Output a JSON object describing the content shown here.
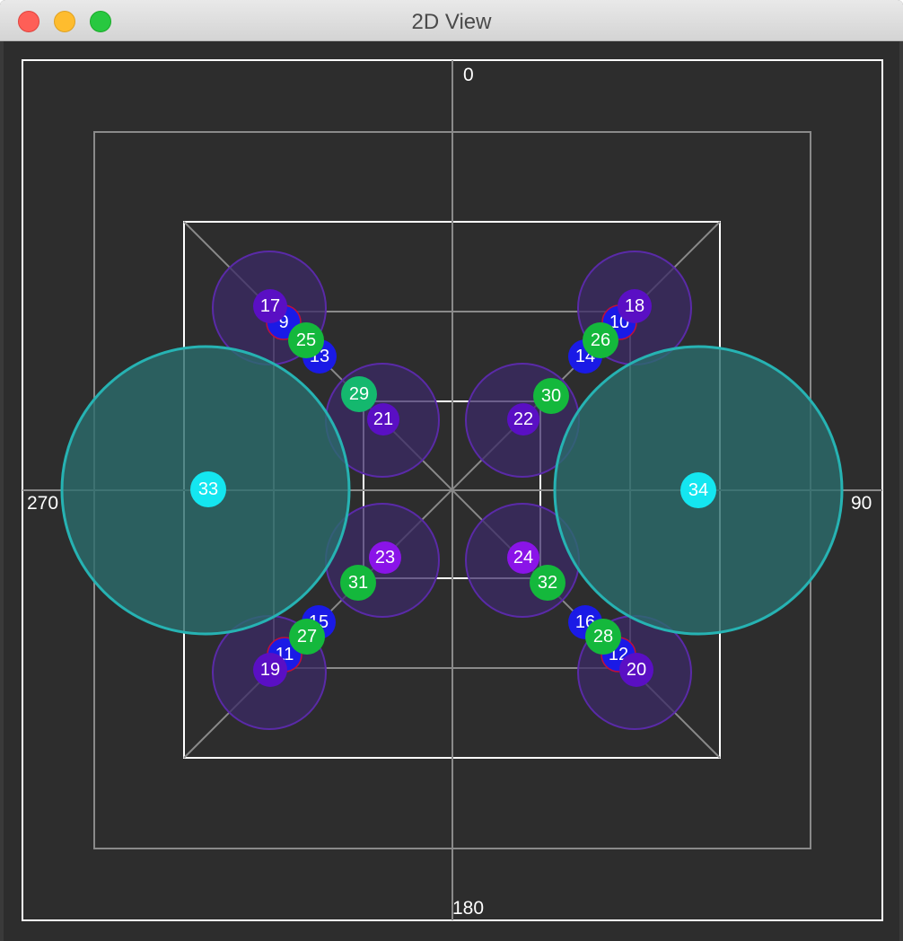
{
  "window": {
    "title": "2D View"
  },
  "axis_labels": {
    "top": "0",
    "right": "90",
    "bottom": "180",
    "left": "270"
  },
  "colors": {
    "background": "#2d2d2d",
    "blue": "#1a1ae6",
    "green": "#14b83c",
    "purple": "#5a0fc4",
    "violet": "#8a14e8",
    "cyan": "#14e6f0",
    "teal_fill": "#2a6b6b",
    "teal_stroke": "#26b3b3",
    "purple_halo_fill": "#3b2a66",
    "purple_halo_stroke": "#5a2aa8"
  },
  "markers": [
    {
      "id": "9",
      "label": "9",
      "color": "blue"
    },
    {
      "id": "10",
      "label": "10",
      "color": "blue"
    },
    {
      "id": "11",
      "label": "11",
      "color": "blue"
    },
    {
      "id": "12",
      "label": "12",
      "color": "blue"
    },
    {
      "id": "13",
      "label": "13",
      "color": "blue"
    },
    {
      "id": "14",
      "label": "14",
      "color": "blue"
    },
    {
      "id": "15",
      "label": "15",
      "color": "blue"
    },
    {
      "id": "16",
      "label": "16",
      "color": "blue"
    },
    {
      "id": "17",
      "label": "17",
      "color": "purple"
    },
    {
      "id": "18",
      "label": "18",
      "color": "purple"
    },
    {
      "id": "19",
      "label": "19",
      "color": "purple"
    },
    {
      "id": "20",
      "label": "20",
      "color": "purple"
    },
    {
      "id": "21",
      "label": "21",
      "color": "purple"
    },
    {
      "id": "22",
      "label": "22",
      "color": "purple"
    },
    {
      "id": "23",
      "label": "23",
      "color": "violet"
    },
    {
      "id": "24",
      "label": "24",
      "color": "violet"
    },
    {
      "id": "25",
      "label": "25",
      "color": "green"
    },
    {
      "id": "26",
      "label": "26",
      "color": "green"
    },
    {
      "id": "27",
      "label": "27",
      "color": "green"
    },
    {
      "id": "28",
      "label": "28",
      "color": "green"
    },
    {
      "id": "29",
      "label": "29",
      "color": "green"
    },
    {
      "id": "30",
      "label": "30",
      "color": "green"
    },
    {
      "id": "31",
      "label": "31",
      "color": "green"
    },
    {
      "id": "32",
      "label": "32",
      "color": "green"
    },
    {
      "id": "33",
      "label": "33",
      "color": "cyan"
    },
    {
      "id": "34",
      "label": "34",
      "color": "cyan"
    }
  ]
}
